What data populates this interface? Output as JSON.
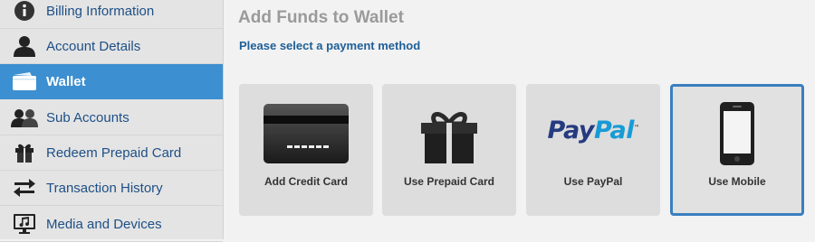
{
  "sidebar": {
    "items": [
      {
        "label": "Billing Information",
        "icon": "info-icon"
      },
      {
        "label": "Account Details",
        "icon": "user-icon"
      },
      {
        "label": "Wallet",
        "icon": "wallet-icon",
        "active": true
      },
      {
        "label": "Sub Accounts",
        "icon": "users-icon"
      },
      {
        "label": "Redeem Prepaid Card",
        "icon": "gift-icon"
      },
      {
        "label": "Transaction History",
        "icon": "swap-arrows-icon"
      },
      {
        "label": "Media and Devices",
        "icon": "media-devices-icon"
      }
    ]
  },
  "main": {
    "title": "Add Funds to Wallet",
    "subtitle": "Please select a payment method",
    "methods": [
      {
        "label": "Add Credit Card",
        "icon": "credit-card-icon"
      },
      {
        "label": "Use Prepaid Card",
        "icon": "gift-box-icon"
      },
      {
        "label": "Use PayPal",
        "icon": "paypal-logo",
        "logo_text_1": "Pay",
        "logo_text_2": "Pal",
        "trademark": "™"
      },
      {
        "label": "Use Mobile",
        "icon": "mobile-phone-icon",
        "selected": true
      }
    ]
  },
  "colors": {
    "sidebar_link": "#1e4f86",
    "active_bg": "#3c8fd0",
    "title": "#9a9a9a",
    "subtitle": "#1e5f98",
    "card_bg": "#dddddd",
    "selected_border": "#3a7fbf",
    "paypal_dark": "#253b80",
    "paypal_light": "#179bd7"
  }
}
